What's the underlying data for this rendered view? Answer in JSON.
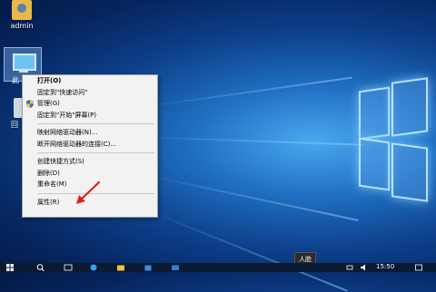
{
  "desktop": {
    "icons": [
      {
        "label": "admin"
      },
      {
        "label": "此"
      },
      {
        "label": "回"
      }
    ]
  },
  "context_menu": {
    "items": [
      {
        "label": "打开(O)",
        "bold": true
      },
      {
        "label": "固定到\"快速访问\""
      },
      {
        "label": "管理(G)",
        "icon": "shield-icon"
      },
      {
        "label": "固定到\"开始\"屏幕(P)"
      },
      {
        "separator": true
      },
      {
        "label": "映射网络驱动器(N)..."
      },
      {
        "label": "断开网络驱动器的连接(C)..."
      },
      {
        "separator": true
      },
      {
        "label": "创建快捷方式(S)"
      },
      {
        "label": "删除(D)"
      },
      {
        "label": "重命名(M)"
      },
      {
        "separator": true
      },
      {
        "label": "属性(R)"
      }
    ]
  },
  "tooltip": {
    "text": "人脸"
  },
  "taskbar": {
    "clock": "15:50",
    "icons": [
      "windows-start-icon",
      "search-icon",
      "task-view-icon",
      "edge-icon",
      "file-explorer-icon",
      "store-icon",
      "mail-icon"
    ]
  },
  "colors": {
    "menu_bg": "#f2f2f2",
    "arrow": "#d9221c",
    "taskbar": "#0b1a33"
  }
}
